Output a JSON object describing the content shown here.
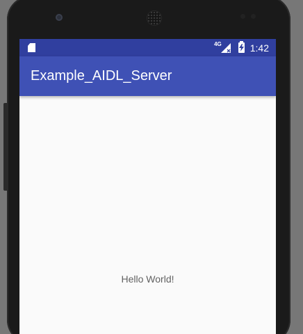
{
  "status_bar": {
    "network_label": "4G",
    "time": "1:42",
    "sd_icon": "sd-card-icon",
    "signal_icon": "signal-icon",
    "battery_icon": "battery-charging-icon"
  },
  "app_bar": {
    "title": "Example_AIDL_Server"
  },
  "content": {
    "message": "Hello World!"
  },
  "colors": {
    "status_bar": "#303f9f",
    "app_bar": "#3f51b5",
    "screen_background": "#fafafa",
    "message_text": "#616161"
  }
}
